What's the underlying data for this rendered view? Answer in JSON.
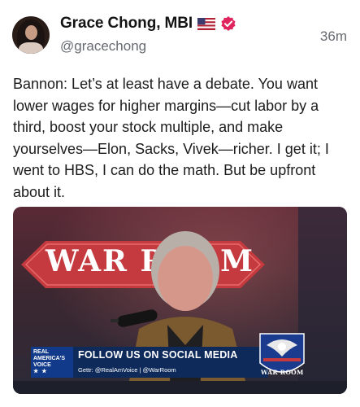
{
  "post": {
    "author_name": "Grace Chong, MBI",
    "flag_emoji": "us-flag-icon",
    "verified": "verified-icon",
    "handle": "@gracechong",
    "timestamp": "36m",
    "text": "Bannon: Let’s at least have a debate. You want lower wages for higher margins—cut labor by a third, boost your stock multiple, and make yourselves—Elon, Sacks, Vivek—richer. I get it; I went to HBS, I can do the math. But be upfront about it."
  },
  "media": {
    "banner_text": "WAR ROOM",
    "lower_third": {
      "network_logo": "REAL AMERICA'S VOICE",
      "title": "FOLLOW US ON SOCIAL MEDIA",
      "subtitle": "Gettr: @RealAmVoice | @WarRoom"
    },
    "badge_text": "WAR ROOM"
  },
  "colors": {
    "verified": "#e0245e",
    "secondary_text": "#666a70",
    "lower_third_bg": "#0e2a5a",
    "network_blue": "#123a8a"
  }
}
